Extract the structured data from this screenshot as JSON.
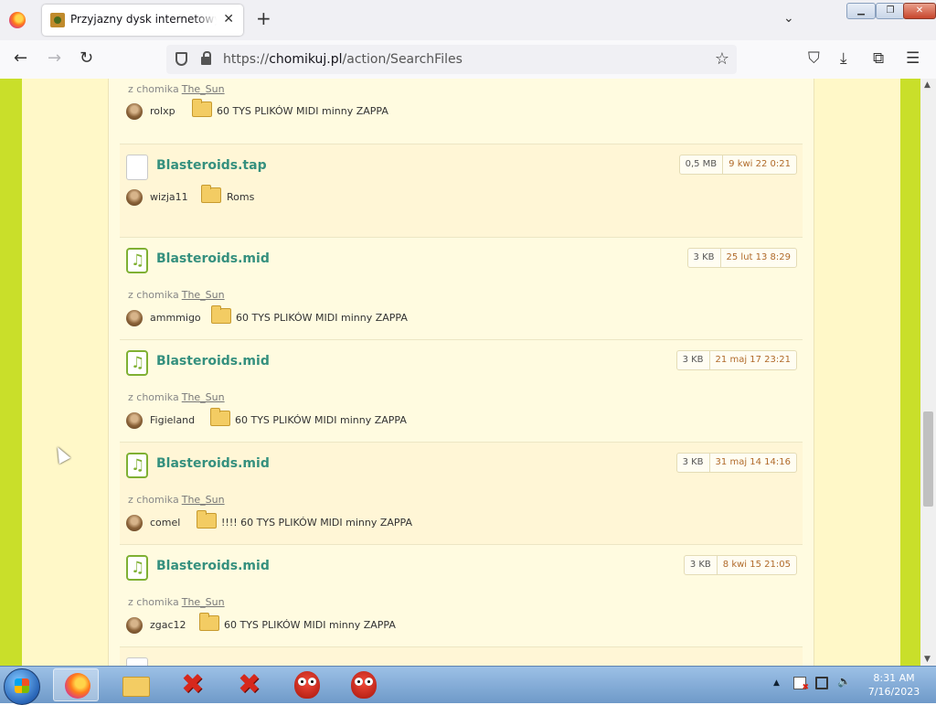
{
  "browser": {
    "tab_title": "Przyjazny dysk internetowy - Chomikuj.pl",
    "tab_close": "✕",
    "new_tab": "+",
    "tab_list": "⌄",
    "back": "←",
    "forward": "→",
    "reload": "↻",
    "url_prefix": "https://",
    "url_host": "chomikuj.pl",
    "url_path": "/action/SearchFiles",
    "bookmark_star": "☆",
    "window_buttons": {
      "minimize": "▁",
      "maximize": "❐",
      "close": "✕"
    },
    "toolbar_icons": [
      "pocket-icon",
      "download-icon",
      "extensions-icon",
      "menu-icon"
    ]
  },
  "results": [
    {
      "partial": true,
      "from_label": "z chomika",
      "from_owner": "The_Sun",
      "user": "rolxp",
      "folder": "60 TYS PLIKÓW MIDI minny ZAPPA"
    },
    {
      "name": "Blasteroids.tap",
      "icon": "file-icon",
      "size": "0,5 MB",
      "date": "9 kwi 22 0:21",
      "user": "wizja11",
      "folder": "Roms"
    },
    {
      "name": "Blasteroids.mid",
      "icon": "music-file-icon",
      "size": "3 KB",
      "date": "25 lut 13 8:29",
      "from_label": "z chomika",
      "from_owner": "The_Sun",
      "user": "ammmigo",
      "folder": "60 TYS PLIKÓW MIDI minny ZAPPA"
    },
    {
      "name": "Blasteroids.mid",
      "icon": "music-file-icon",
      "size": "3 KB",
      "date": "21 maj 17 23:21",
      "from_label": "z chomika",
      "from_owner": "The_Sun",
      "user": "Figieland",
      "folder": "60 TYS PLIKÓW MIDI minny ZAPPA"
    },
    {
      "name": "Blasteroids.mid",
      "icon": "music-file-icon",
      "size": "3 KB",
      "date": "31 maj 14 14:16",
      "from_label": "z chomika",
      "from_owner": "The_Sun",
      "user": "comel",
      "folder": "!!!! 60 TYS PLIKÓW MIDI minny ZAPPA"
    },
    {
      "name": "Blasteroids.mid",
      "icon": "music-file-icon",
      "size": "3 KB",
      "date": "8 kwi 15 21:05",
      "from_label": "z chomika",
      "from_owner": "The_Sun",
      "user": "zgac12",
      "folder": "60 TYS PLIKÓW MIDI minny ZAPPA"
    }
  ],
  "taskbar": {
    "apps": [
      "start-button",
      "firefox-icon",
      "file-explorer-icon",
      "red-x-app-icon",
      "red-x-app-icon",
      "red-bug-app-icon",
      "red-bug-app-icon"
    ],
    "time": "8:31 AM",
    "date": "7/16/2023"
  },
  "colors": {
    "page_background": "#fff8c8",
    "side_rail": "#c9df2a",
    "file_name": "#35907e",
    "date_text": "#b06a2a"
  }
}
